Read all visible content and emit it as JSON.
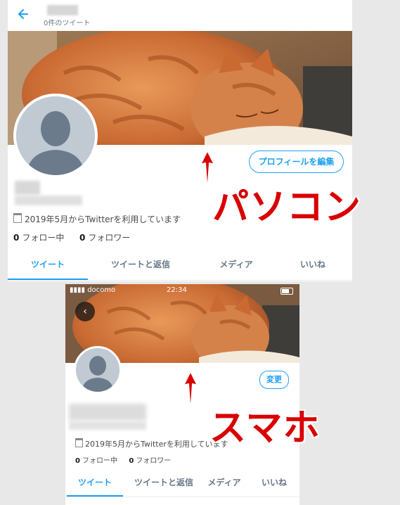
{
  "desktop": {
    "header": {
      "back_icon": "arrow-left-icon",
      "tweet_count": "0件のツイート"
    },
    "edit_profile_label": "プロフィールを編集",
    "joined": "2019年5月からTwitterを利用しています",
    "following_count": "0",
    "following_label": "フォロー中",
    "followers_count": "0",
    "followers_label": "フォロワー",
    "tabs": [
      {
        "label": "ツイート",
        "active": true
      },
      {
        "label": "ツイートと返信",
        "active": false
      },
      {
        "label": "メディア",
        "active": false
      },
      {
        "label": "いいね",
        "active": false
      }
    ]
  },
  "mobile": {
    "status_bar": {
      "carrier": "docomo",
      "time": "22:34"
    },
    "back_icon": "chevron-left-icon",
    "edit_label": "変更",
    "joined": "2019年5月からTwitterを利用しています",
    "following_count": "0",
    "following_label": "フォロー中",
    "followers_count": "0",
    "followers_label": "フォロワー",
    "tabs": [
      {
        "label": "ツイート",
        "active": true
      },
      {
        "label": "ツイートと返信",
        "active": false
      },
      {
        "label": "メディア",
        "active": false
      },
      {
        "label": "いいね",
        "active": false
      }
    ]
  },
  "annotations": {
    "pc_label": "パソコン",
    "phone_label": "スマホ"
  },
  "colors": {
    "accent": "#1da1f2",
    "annotation_red": "#d80000",
    "banner_cat": "#c96a33"
  }
}
